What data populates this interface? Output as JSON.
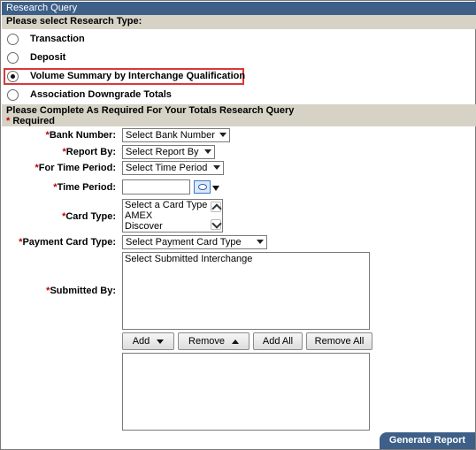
{
  "title": "Research Query",
  "research_type": {
    "heading": "Please select Research Type:",
    "options": [
      "Transaction",
      "Deposit",
      "Volume Summary by Interchange Qualification",
      "Association Downgrade Totals"
    ],
    "selected": "Volume Summary by Interchange Qualification"
  },
  "form": {
    "heading": "Please Complete As Required For Your Totals Research Query",
    "required_star": "*",
    "required_note": " Required",
    "bank_number": {
      "label": "Bank Number:",
      "value": "Select Bank Number"
    },
    "report_by": {
      "label": "Report By:",
      "value": "Select Report By"
    },
    "time_period_for": {
      "label": "For Time Period:",
      "value": "Select Time Period"
    },
    "time_period": {
      "label": "Time Period:",
      "value": ""
    },
    "card_type": {
      "label": "Card Type:",
      "options": [
        "Select a Card Type",
        "AMEX",
        "Discover"
      ]
    },
    "payment_card_type": {
      "label": "Payment Card Type:",
      "value": "Select Payment Card Type"
    },
    "submitted_by": {
      "label": "Submitted By:",
      "options": [
        "Select Submitted Interchange"
      ]
    }
  },
  "buttons": {
    "add": "Add",
    "remove": "Remove",
    "add_all": "Add All",
    "remove_all": "Remove All",
    "generate": "Generate Report"
  },
  "colors": {
    "header_blue": "#3d5f88",
    "section_gray": "#d6d3c6",
    "highlight_red": "#d9383a",
    "required_red": "#c00000"
  }
}
